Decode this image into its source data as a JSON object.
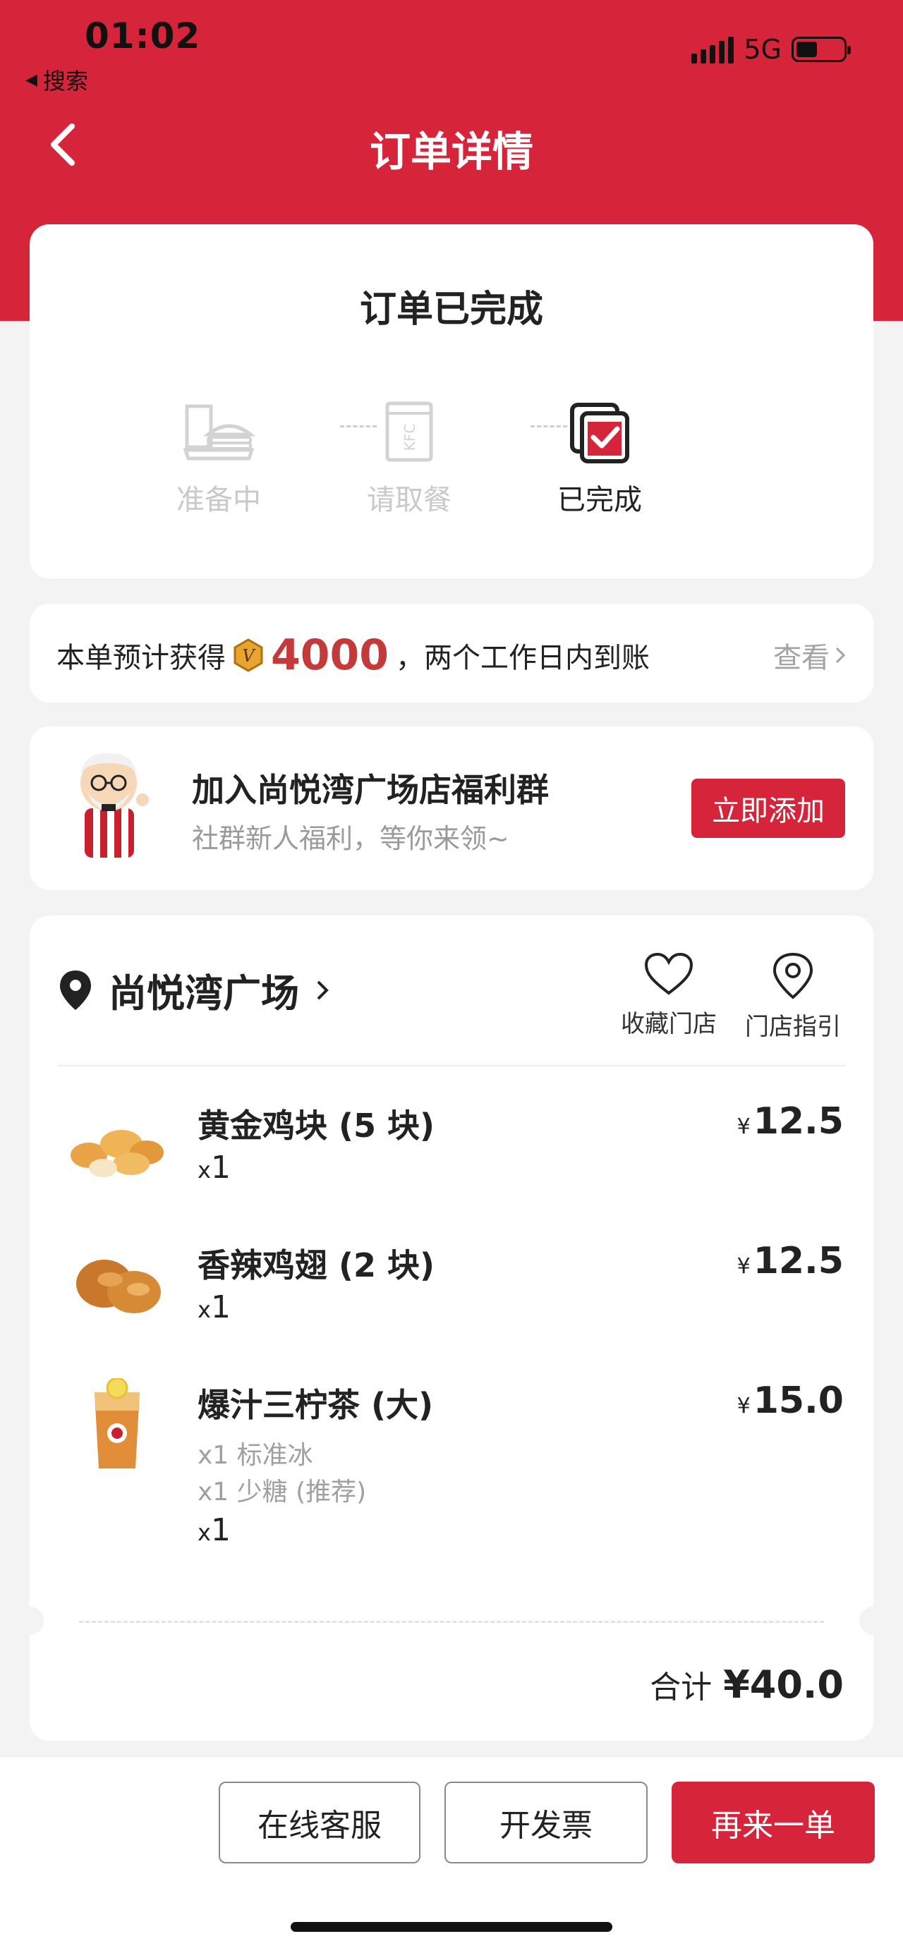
{
  "status_bar": {
    "time": "01:02",
    "back_label": "搜索",
    "network": "5G"
  },
  "nav": {
    "title": "订单详情"
  },
  "order_status": {
    "title": "订单已完成",
    "steps": [
      {
        "label": "准备中",
        "icon": "tray-burger-icon"
      },
      {
        "label": "请取餐",
        "icon": "kfc-bag-icon"
      },
      {
        "label": "已完成",
        "icon": "completed-check-icon"
      }
    ],
    "active_step": 2
  },
  "points": {
    "prefix": "本单预计获得",
    "amount": "4000",
    "suffix": "，两个工作日内到账",
    "view_label": "查看"
  },
  "group": {
    "title": "加入尚悦湾广场店福利群",
    "subtitle": "社群新人福利，等你来领~",
    "button": "立即添加"
  },
  "store": {
    "name": "尚悦湾广场",
    "favorite_label": "收藏门店",
    "guide_label": "门店指引"
  },
  "items": [
    {
      "name": "黄金鸡块 (5 块)",
      "qty": "1",
      "price": "12.5",
      "specs": []
    },
    {
      "name": "香辣鸡翅 (2 块)",
      "qty": "1",
      "price": "12.5",
      "specs": []
    },
    {
      "name": "爆汁三柠茶 (大)",
      "qty": "1",
      "price": "15.0",
      "specs": [
        "x1 标准冰",
        "x1 少糖 (推荐)"
      ]
    }
  ],
  "currency": "¥",
  "qty_prefix": "x",
  "total": {
    "label": "合计",
    "amount": "¥40.0"
  },
  "actions": {
    "service": "在线客服",
    "invoice": "开发票",
    "reorder": "再来一单"
  },
  "colors": {
    "brand_red": "#d6243a",
    "points_red": "#c43a3a"
  }
}
